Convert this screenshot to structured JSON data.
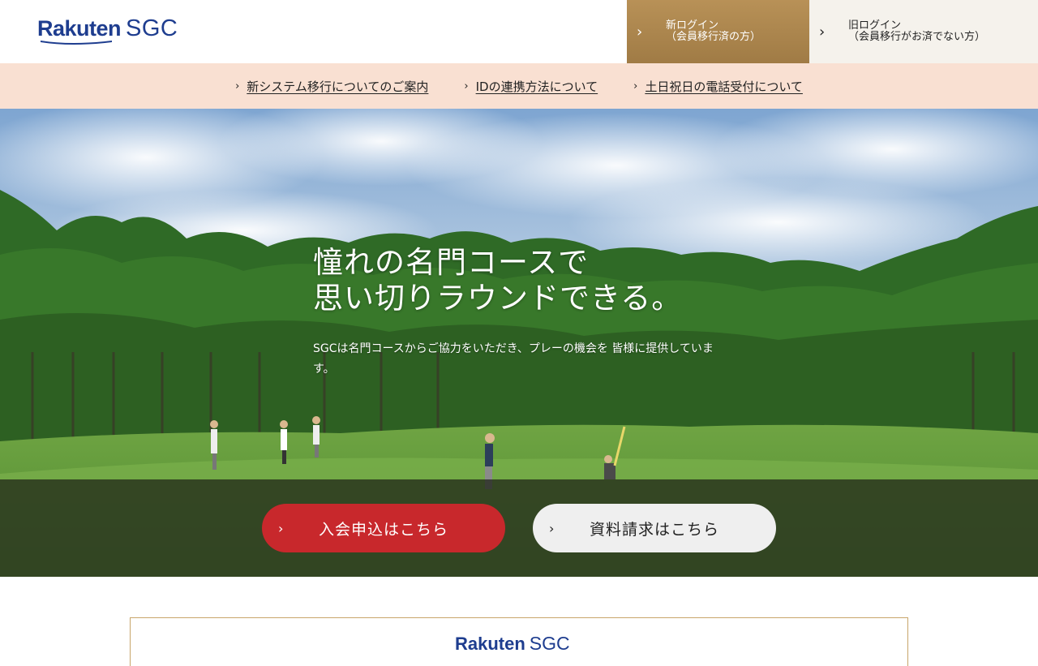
{
  "header": {
    "logo_rakuten": "Rakuten",
    "logo_sgc": "SGC",
    "login_new": {
      "line1": "新ログイン",
      "line2": "（会員移行済の方）"
    },
    "login_old": {
      "line1": "旧ログイン",
      "line2": "（会員移行がお済でない方）"
    }
  },
  "infobar": {
    "links": [
      {
        "label": "新システム移行についてのご案内"
      },
      {
        "label": "IDの連携方法について"
      },
      {
        "label": "土日祝日の電話受付について"
      }
    ]
  },
  "hero": {
    "title_line1": "憧れの名門コースで",
    "title_line2": "思い切りラウンドできる。",
    "subtitle": "SGCは名門コースからご協力をいただき、プレーの機会を 皆様に提供しています。"
  },
  "cta": {
    "join_label": "入会申込はこちら",
    "doc_label": "資料請求はこちら"
  },
  "card": {
    "logo_rakuten": "Rakuten",
    "logo_sgc": "SGC"
  },
  "colors": {
    "brand_blue": "#1e3d8f",
    "gold": "#b89157",
    "cta_red": "#c8282c",
    "infobar_bg": "#f9e0d2"
  },
  "icons": {
    "chevron": "chevron-right-icon"
  }
}
